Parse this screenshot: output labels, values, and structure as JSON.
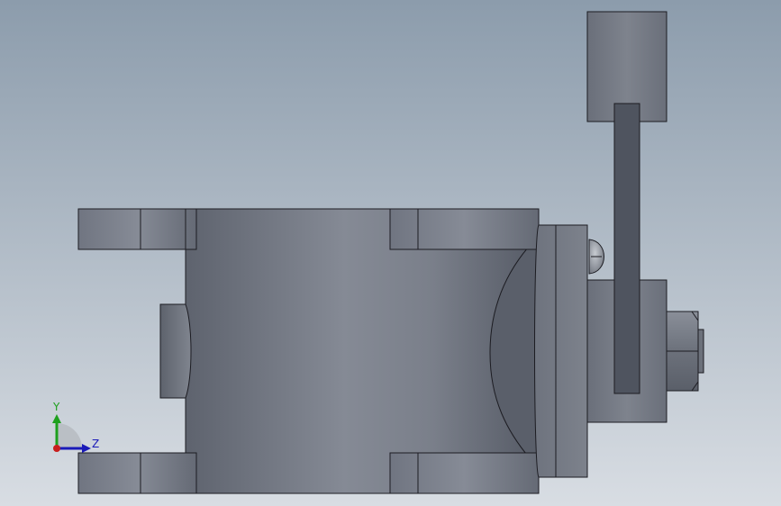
{
  "viewport": {
    "background_top": "#8c9cac",
    "background_bottom": "#d8dde3",
    "model_base": "#767c88",
    "model_dark": "#505560",
    "model_light": "#8b909b",
    "edge": "#1c1c22"
  },
  "triad": {
    "y_label": "Y",
    "z_label": "Z",
    "y_color": "#1ea01e",
    "z_color": "#1a1ab8",
    "x_color": "#c81e1e"
  },
  "parts": [
    "valve-body",
    "top-flange",
    "bottom-flange",
    "left-seat",
    "bonnet-flange",
    "stem-housing",
    "handle-lever",
    "counterweight",
    "hex-nut",
    "bolt-head-upper",
    "bolt-head-lower"
  ]
}
